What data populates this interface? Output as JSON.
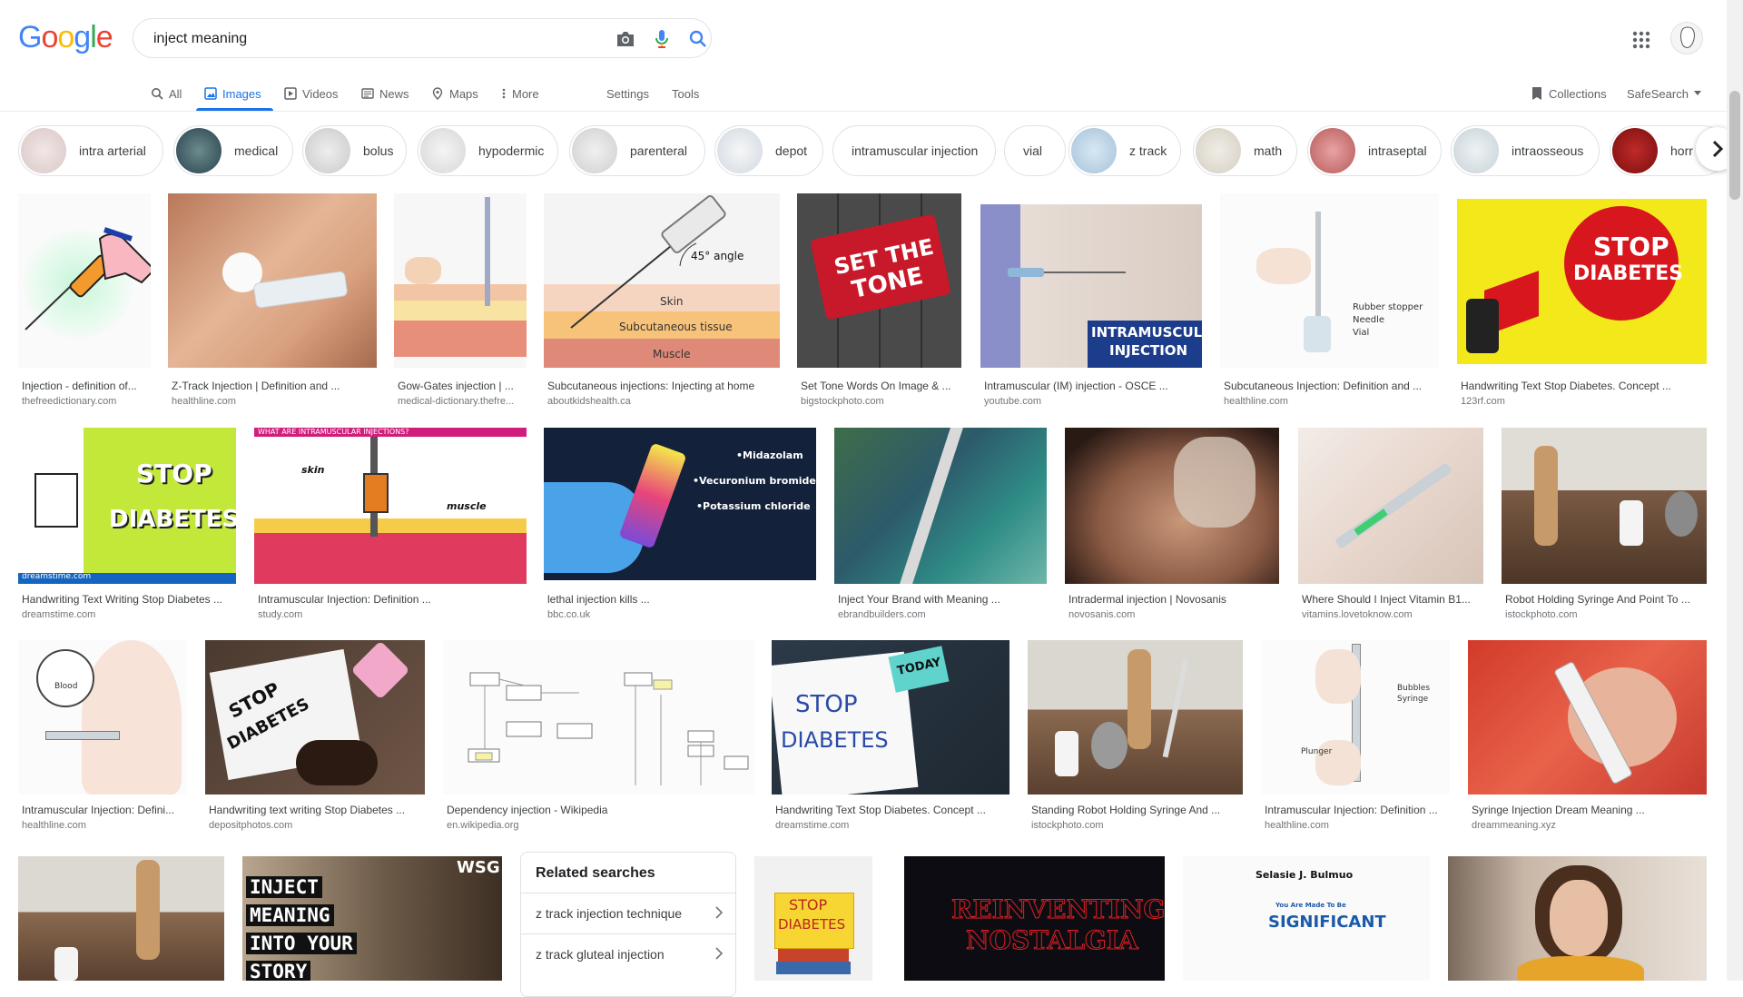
{
  "header": {
    "logo": [
      "G",
      "o",
      "o",
      "g",
      "l",
      "e"
    ],
    "logo_colors": [
      "#4285f4",
      "#ea4335",
      "#fbbc05",
      "#4285f4",
      "#34a853",
      "#ea4335"
    ],
    "search_value": "inject meaning",
    "icons": [
      "camera-icon",
      "mic-icon",
      "search-icon",
      "apps-icon"
    ]
  },
  "tabs": {
    "all": "All",
    "images": "Images",
    "videos": "Videos",
    "news": "News",
    "maps": "Maps",
    "more": "More",
    "settings": "Settings",
    "tools": "Tools",
    "collections": "Collections",
    "safesearch": "SafeSearch"
  },
  "chips": [
    "intra arterial",
    "medical",
    "bolus",
    "hypodermic",
    "parenteral",
    "depot",
    "intramuscular injection",
    "vial",
    "z track",
    "math",
    "intraseptal",
    "intraosseous",
    "horr"
  ],
  "row1": [
    {
      "caption": "Injection - definition of...",
      "source": "thefreedictionary.com"
    },
    {
      "caption": "Z-Track Injection | Definition and ...",
      "source": "healthline.com"
    },
    {
      "caption": "Gow-Gates injection | ...",
      "source": "medical-dictionary.thefre..."
    },
    {
      "caption": "Subcutaneous injections: Injecting at home",
      "source": "aboutkidshealth.ca"
    },
    {
      "caption": "Set Tone Words On Image & ...",
      "source": "bigstockphoto.com"
    },
    {
      "caption": "Intramuscular (IM) injection - OSCE ...",
      "source": "youtube.com"
    },
    {
      "caption": "Subcutaneous Injection: Definition and ...",
      "source": "healthline.com"
    },
    {
      "caption": "Handwriting Text Stop Diabetes. Concept ...",
      "source": "123rf.com"
    }
  ],
  "row2": [
    {
      "caption": "Handwriting Text Writing Stop Diabetes ...",
      "source": "dreamstime.com"
    },
    {
      "caption": "Intramuscular Injection: Definition ...",
      "source": "study.com"
    },
    {
      "caption": "lethal injection kills ...",
      "source": "bbc.co.uk"
    },
    {
      "caption": "Inject Your Brand with Meaning ...",
      "source": "ebrandbuilders.com"
    },
    {
      "caption": "Intradermal injection | Novosanis",
      "source": "novosanis.com"
    },
    {
      "caption": "Where Should I Inject Vitamin B1...",
      "source": "vitamins.lovetoknow.com"
    },
    {
      "caption": "Robot Holding Syringe And Point To ...",
      "source": "istockphoto.com"
    }
  ],
  "row3": [
    {
      "caption": "Intramuscular Injection: Defini...",
      "source": "healthline.com"
    },
    {
      "caption": "Handwriting text writing Stop Diabetes ...",
      "source": "depositphotos.com"
    },
    {
      "caption": "Dependency injection - Wikipedia",
      "source": "en.wikipedia.org"
    },
    {
      "caption": "Handwriting Text Stop Diabetes. Concept ...",
      "source": "dreamstime.com"
    },
    {
      "caption": "Standing Robot Holding Syringe And ...",
      "source": "istockphoto.com"
    },
    {
      "caption": "Intramuscular Injection: Definition ...",
      "source": "healthline.com"
    },
    {
      "caption": "Syringe Injection Dream Meaning ...",
      "source": "dreammeaning.xyz"
    }
  ],
  "image_text": {
    "angle": "45° angle",
    "skin": "Skin",
    "subcutaneous": "Subcutaneous tissue",
    "muscle": "Muscle",
    "set_tone_1": "SET THE",
    "set_tone_2": "TONE",
    "intramuscular_1": "INTRAMUSCULA",
    "intramuscular_2": "INJECTION",
    "stop": "STOP",
    "diabetes": "DIABETES",
    "study_header": "WHAT ARE INTRAMUSCULAR INJECTIONS?",
    "skin_lc": "skin",
    "muscle_lc": "muscle",
    "midazolam": "•Midazolam",
    "vecuronium": "•Vecuronium bromide",
    "potassium": "•Potassium chloride",
    "rubber": "Rubber stopper",
    "needle": "Needle",
    "vial": "Vial",
    "dreamstime": "dreamstime.com",
    "today": "TODAY",
    "blood": "Blood",
    "bubbles": "Bubbles",
    "syringe": "Syringe",
    "plunger": "Plunger",
    "inject_1": "INJECT",
    "inject_2": "MEANING",
    "inject_3": "INTO YOUR",
    "inject_4": "STORY",
    "wsg": "WSG",
    "reinventing_1": "REINVENTING",
    "reinventing_2": "NOSTALGIA",
    "selasie": "Selasie J. Bulmuo",
    "made": "You Are Made To Be",
    "significant": "SIGNIFICANT"
  },
  "related": {
    "title": "Related searches",
    "items": [
      "z track injection technique",
      "z track gluteal injection"
    ]
  }
}
